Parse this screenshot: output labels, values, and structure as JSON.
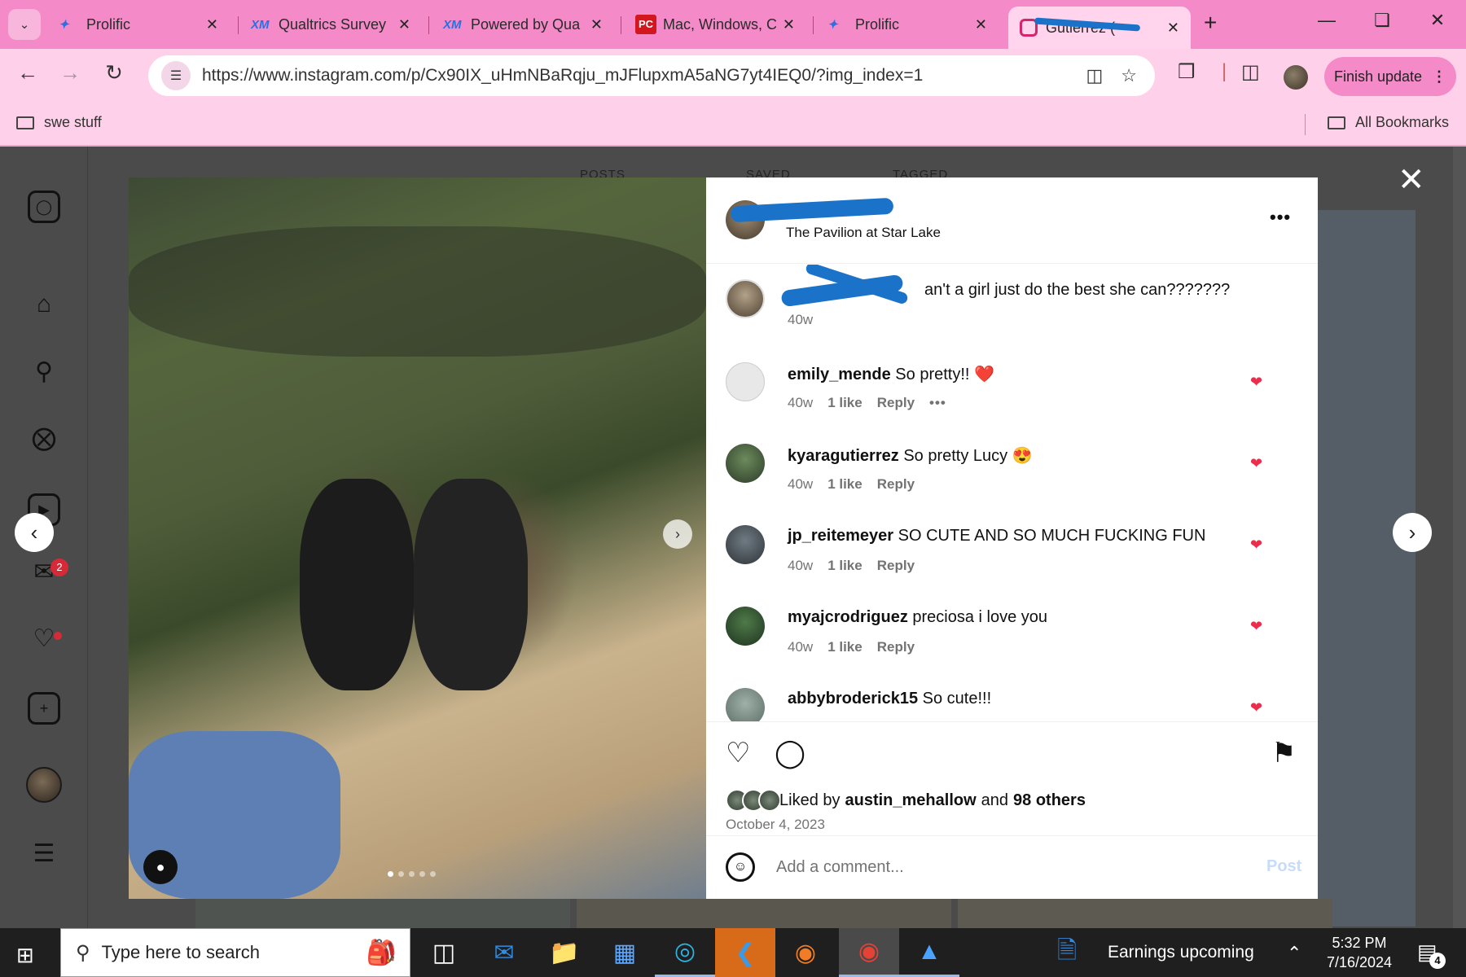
{
  "browser": {
    "tabs": [
      {
        "title": "Prolific",
        "favicon": "prolific-icon"
      },
      {
        "title": "Qualtrics Survey",
        "favicon": "qualtrics-icon",
        "favicon_text": "XM"
      },
      {
        "title": "Powered by Qua",
        "favicon": "qualtrics-icon",
        "favicon_text": "XM"
      },
      {
        "title": "Mac, Windows, C",
        "favicon": "pcmag-icon",
        "favicon_text": "PC"
      },
      {
        "title": "Prolific",
        "favicon": "prolific-icon"
      },
      {
        "title": "Gutierrez (",
        "favicon": "instagram-icon",
        "active": true
      }
    ],
    "url": "https://www.instagram.com/p/Cx90IX_uHmNBaRqju_mJFlupxmA5aNG7yt4IEQ0/?img_index=1",
    "finish_update_label": "Finish update",
    "bookmarks": {
      "left": "swe stuff",
      "right": "All Bookmarks"
    }
  },
  "instagram": {
    "background_tabs": [
      "POSTS",
      "SAVED",
      "TAGGED"
    ],
    "nav_messages_badge": "2",
    "post": {
      "location": "The Pavilion at Star Lake",
      "caption": {
        "text": "an't a girl just do the best she can???????",
        "time": "40w"
      },
      "comments": [
        {
          "user": "emily_mende",
          "text": "So pretty!!",
          "emoji": "❤️",
          "time": "40w",
          "likes": "1 like",
          "reply": "Reply",
          "liked": true,
          "has_more": true
        },
        {
          "user": "kyaragutierrez",
          "text": "So pretty Lucy",
          "emoji": "😍",
          "time": "40w",
          "likes": "1 like",
          "reply": "Reply",
          "liked": true
        },
        {
          "user": "jp_reitemeyer",
          "text": "SO CUTE AND SO MUCH FUCKING FUN",
          "time": "40w",
          "likes": "1 like",
          "reply": "Reply",
          "liked": true
        },
        {
          "user": "myajcrodriguez",
          "text": "preciosa i love you",
          "time": "40w",
          "likes": "1 like",
          "reply": "Reply",
          "liked": true
        },
        {
          "user": "abbybroderick15",
          "text": "So cute!!!",
          "liked": true
        }
      ],
      "liked_by": {
        "prefix": "Liked by",
        "user": "austin_mehallow",
        "joiner": "and",
        "others": "98 others"
      },
      "date": "October 4, 2023",
      "add_comment_placeholder": "Add a comment...",
      "post_button": "Post"
    }
  },
  "taskbar": {
    "search_placeholder": "Type here to search",
    "news_text": "Earnings upcoming",
    "time": "5:32 PM",
    "date": "7/16/2024",
    "notification_count": "4"
  },
  "colors": {
    "chrome_accent": "#f58ac9",
    "chrome_toolbar": "#ffd0ea",
    "like_red": "#ed2d4c",
    "redaction_blue": "#1a73c9"
  }
}
